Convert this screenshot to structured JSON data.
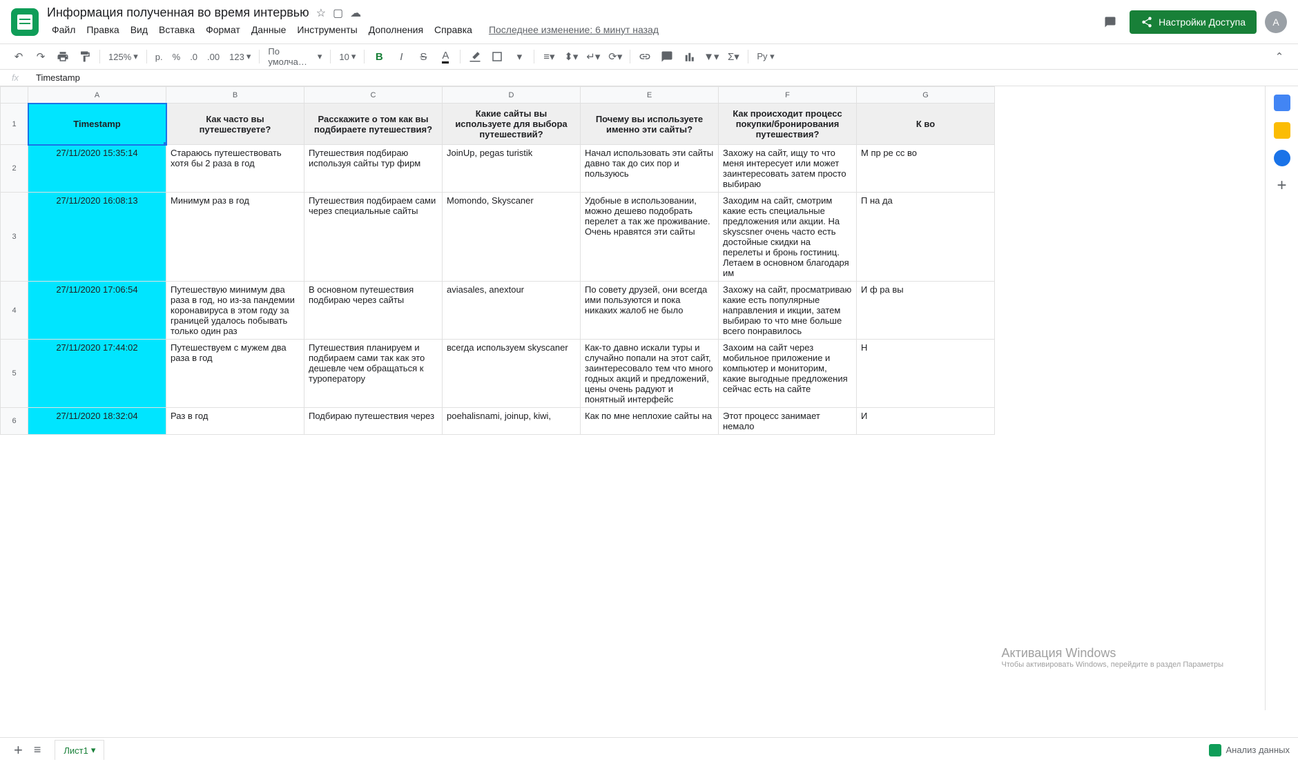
{
  "doc": {
    "title": "Информация полученная во время интервью"
  },
  "menu": {
    "file": "Файл",
    "edit": "Правка",
    "view": "Вид",
    "insert": "Вставка",
    "format": "Формат",
    "data": "Данные",
    "tools": "Инструменты",
    "addons": "Дополнения",
    "help": "Справка",
    "last_edit": "Последнее изменение: 6 минут назад"
  },
  "share": {
    "label": "Настройки Доступа"
  },
  "avatar": "A",
  "toolbar": {
    "zoom": "125%",
    "currency": "р.",
    "percent": "%",
    "dec_dec": ".0",
    "dec_inc": ".00",
    "more_fmt": "123",
    "font": "По умолча…",
    "font_size": "10"
  },
  "fx": {
    "value": "Timestamp"
  },
  "columns": [
    "",
    "A",
    "B",
    "C",
    "D",
    "E",
    "F",
    "G"
  ],
  "headers": {
    "a": "Timestamp",
    "b": "Как часто вы путешествуете?",
    "c": "Расскажите о том как вы подбираете путешествия?",
    "d": "Какие сайты вы используете для выбора путешествий?",
    "e": "Почему вы используете именно эти сайты?",
    "f": "Как происходит процесс покупки/бронирования путешествия?",
    "g": "К во"
  },
  "rows": [
    {
      "n": "2",
      "a": "27/11/2020 15:35:14",
      "b": "Стараюсь путешествовать хотя бы 2 раза в год",
      "c": "Путешествия подбираю используя сайты тур фирм",
      "d": "JoinUp, pegas turistik",
      "e": "Начал использовать эти сайты давно так до сих пор и пользуюсь",
      "f": "Захожу на сайт, ищу то что меня интересует или может заинтересовать затем просто выбираю",
      "g": "М пр ре сс во"
    },
    {
      "n": "3",
      "a": "27/11/2020 16:08:13",
      "b": "Минимум раз в год",
      "c": "Путешествия подбираем сами через специальные сайты",
      "d": "Momondo, Skyscaner",
      "e": "Удобные в использовании, можно дешево подобрать перелет а так же проживание. Очень нравятся эти сайты",
      "f": "Заходим на сайт, смотрим какие есть специальные предложения или акции. На skyscsner очень часто есть достойные скидки на перелеты и бронь гостиниц. Летаем в основном благодаря им",
      "g": "П на да"
    },
    {
      "n": "4",
      "a": "27/11/2020 17:06:54",
      "b": "Путешествую минимум два раза в год, но из-за пандемии коронавируса в этом году за границей удалось побывать только один раз",
      "c": "В основном путешествия подбираю через сайты",
      "d": "aviasales, anextour",
      "e": "По совету друзей, они всегда ими пользуются и пока никаких жалоб не было",
      "f": "Захожу на сайт, просматриваю какие есть популярные направления и икции, затем выбираю то что мне больше всего понравилось",
      "g": "И ф ра вы"
    },
    {
      "n": "5",
      "a": "27/11/2020 17:44:02",
      "b": "Путешествуем с мужем два раза в год",
      "c": "Путешествия планируем и подбираем сами так как это дешевле чем обращаться к туроператору",
      "d": "всегда используем skyscaner",
      "e": "Как-то давно искали туры и случайно попали на этот сайт, заинтересовало тем что много годных акций и предложений, цены очень радуют и понятный интерфейс",
      "f": "Захоим на сайт через мобильное приложение и компьютер и мониторим, какие выгодные предложения сейчас есть на сайте",
      "g": "Н"
    },
    {
      "n": "6",
      "a": "27/11/2020 18:32:04",
      "b": "Раз в год",
      "c": "Подбираю путешествия через",
      "d": "poehalisnami, joinup, kiwi,",
      "e": "Как по мне неплохие сайты на",
      "f": "Этот процесс занимает немало",
      "g": "И"
    }
  ],
  "sheet_tab": "Лист1",
  "analyze": "Анализ данных",
  "watermark": {
    "title": "Активация Windows",
    "sub": "Чтобы активировать Windows, перейдите в раздел Параметры"
  }
}
